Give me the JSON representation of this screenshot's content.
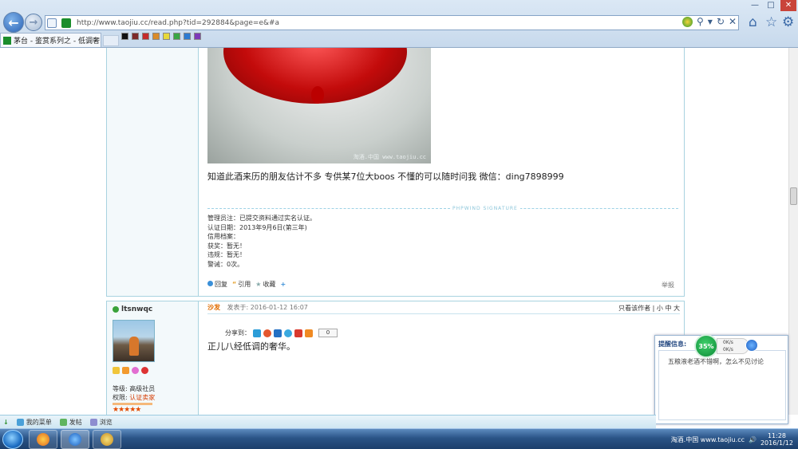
{
  "browser": {
    "url": "http://www.taojiu.cc/read.php?tid=292884&page=e&#a",
    "tab_title": "茅台 - 鉴赏系列之 - 低调奢...",
    "window_min": "—",
    "window_max": "□",
    "window_close": "✕"
  },
  "post1": {
    "photo_watermark": "淘酒.中国 www.taojiu.cc",
    "body_text": "知道此酒来历的朋友估计不多  专供某7位大boos 不懂的可以随时问我  微信：ding7898999",
    "signature_label": "PHPWIND SIGNATURE",
    "signature_lines": [
      "管理员注：已提交资料通过实名认证。",
      "认证日期：2013年9月6日(第三年)",
      "信用档案：",
      "获奖：暂无！",
      "违规：暂无！",
      "警诫：0次。"
    ],
    "actions": {
      "reply": "回复",
      "quote": "引用",
      "favorite": "收藏",
      "more": "+"
    },
    "report": "举报"
  },
  "post2": {
    "username": "ltsnwqc",
    "floor": "沙发",
    "posted_at": "发表于: 2016-01-12 16:07",
    "view_author": "只看该作者",
    "font_small": "小",
    "font_mid": "中",
    "font_large": "大",
    "share_label": "分享到：",
    "share_count": "0",
    "body_text": "正儿八经低调的奢华。",
    "level_label": "等级:",
    "level_value": "高级社员",
    "perm_label": "权限:",
    "perm_value": "认证卖家",
    "stars": "★★★★★"
  },
  "reminder": {
    "title": "提醒信息:",
    "message": "五粮液老酒不错啊，怎么不见讨论",
    "speed_percent": "35%",
    "upload": "0K/s",
    "download": "0K/s"
  },
  "forumbar": {
    "my_menu": "我的菜单",
    "posts": "发帖",
    "browse": "浏览"
  },
  "taskbar": {
    "time": "11:28",
    "date": "2016/1/12",
    "tray_text": "淘酒.中国 www.taojiu.cc"
  }
}
